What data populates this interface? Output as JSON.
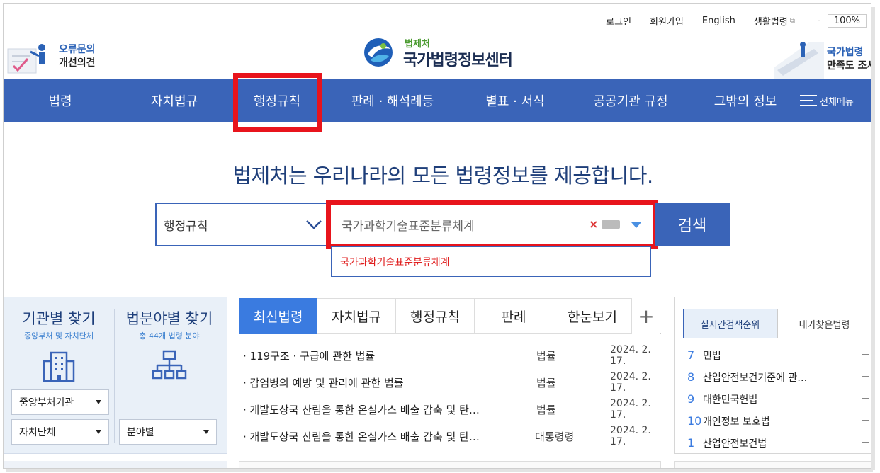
{
  "util": {
    "login": "로그인",
    "join": "회원가입",
    "english": "English",
    "living": "생활법령",
    "zoom_minus": "-",
    "zoom": "100%"
  },
  "left_banner": {
    "line1": "오류문의",
    "line2": "개선의견"
  },
  "logo": {
    "sub": "법제처",
    "main": "국가법령정보센터"
  },
  "right_banner": {
    "line1": "국가법령",
    "line2": "만족도 조사"
  },
  "nav": {
    "items": [
      "법령",
      "자치법규",
      "행정규칙",
      "판례 · 해석례등",
      "별표 · 서식",
      "공공기관 규정",
      "그밖의 정보"
    ],
    "all_menu": "전체메뉴"
  },
  "headline": "법제처는 우리나라의 모든 법령정보를 제공합니다.",
  "search": {
    "kind": "행정규칙",
    "value": "국가과학기술표준분류체계",
    "button": "검색",
    "suggestion": "국가과학기술표준분류체계",
    "clear": "×"
  },
  "finder": {
    "org_title": "기관별 찾기",
    "org_sub": "중앙부처 및 자치단체",
    "field_title": "법분야별 찾기",
    "field_sub": "총 44개 법령 분야",
    "sel_central": "중앙부처기관",
    "sel_local": "자치단체",
    "sel_field": "분야별"
  },
  "tabs": {
    "items": [
      "최신법령",
      "자치법규",
      "행정규칙",
      "판례",
      "한눈보기"
    ],
    "plus": "+"
  },
  "laws": [
    {
      "title": "· 119구조 · 구급에 관한 법률",
      "kind": "법률",
      "date": "2024. 2. 17."
    },
    {
      "title": "· 감염병의 예방 및 관리에 관한 법률",
      "kind": "법률",
      "date": "2024. 2. 17."
    },
    {
      "title": "· 개발도상국 산림을 통한 온실가스 배출 감축 및 탄…",
      "kind": "법률",
      "date": "2024. 2. 17."
    },
    {
      "title": "· 개발도상국 산림을 통한 온실가스 배출 감축 및 탄…",
      "kind": "대통령령",
      "date": "2024. 2. 17."
    }
  ],
  "rank": {
    "tab_live": "실시간검색순위",
    "tab_mine": "내가찾은법령",
    "items": [
      {
        "n": "7",
        "label": "민법"
      },
      {
        "n": "8",
        "label": "산업안전보건기준에 관…"
      },
      {
        "n": "9",
        "label": "대한민국헌법"
      },
      {
        "n": "10",
        "label": "개인정보 보호법"
      },
      {
        "n": "1",
        "label": "산업안전보건법"
      }
    ]
  },
  "colors": {
    "nav": "#3a64b8",
    "highlight": "#e8141c",
    "active_tab": "#3a7be0"
  }
}
